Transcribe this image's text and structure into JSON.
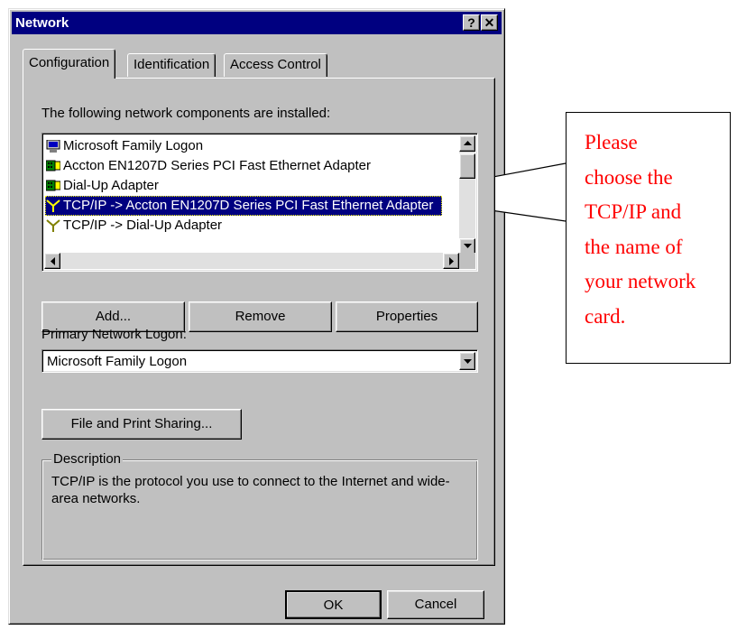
{
  "window": {
    "title": "Network",
    "help_glyph": "?",
    "close_glyph": "✕"
  },
  "tabs": [
    {
      "label": "Configuration",
      "active": true
    },
    {
      "label": "Identification",
      "active": false
    },
    {
      "label": "Access Control",
      "active": false
    }
  ],
  "components": {
    "heading": "The following network components are installed:",
    "items": [
      {
        "label": "Microsoft Family Logon",
        "icon": "computer-icon",
        "selected": false
      },
      {
        "label": "Accton EN1207D Series PCI Fast Ethernet Adapter",
        "icon": "network-card-icon",
        "selected": false
      },
      {
        "label": "Dial-Up Adapter",
        "icon": "network-card-icon",
        "selected": false
      },
      {
        "label": "TCP/IP -> Accton EN1207D Series PCI Fast Ethernet Adapter",
        "icon": "protocol-icon",
        "selected": true
      },
      {
        "label": "TCP/IP -> Dial-Up Adapter",
        "icon": "protocol-icon",
        "selected": false
      }
    ]
  },
  "buttons": {
    "add": "Add...",
    "remove": "Remove",
    "properties": "Properties",
    "file_and_print": "File and Print Sharing...",
    "ok": "OK",
    "cancel": "Cancel"
  },
  "logon": {
    "label": "Primary Network Logon:",
    "value": "Microsoft Family Logon"
  },
  "description": {
    "legend": "Description",
    "text": "TCP/IP is the protocol you use to connect to the Internet and wide-area networks."
  },
  "callout": {
    "text": "Please\nchoose the\nTCP/IP and\nthe name of\nyour network\ncard.",
    "color": "#ff0000"
  },
  "colors": {
    "title_bar": "#000080",
    "face": "#c0c0c0",
    "selection": "#000080"
  }
}
